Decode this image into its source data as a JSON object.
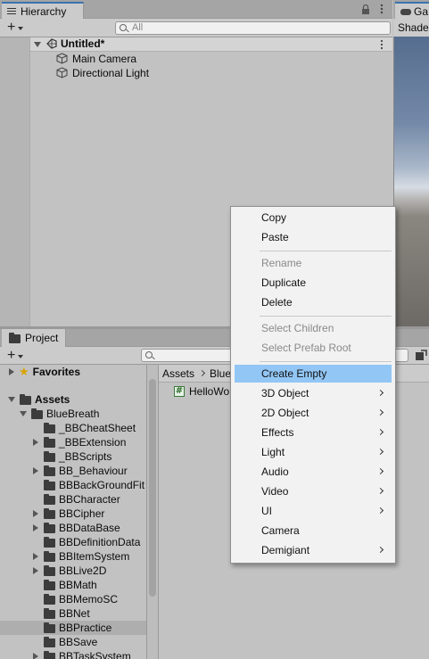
{
  "hierarchy": {
    "tab_label": "Hierarchy",
    "add_label": "+",
    "search_placeholder": "All",
    "scene_name": "Untitled*",
    "objects": [
      "Main Camera",
      "Directional Light"
    ]
  },
  "game_panel": {
    "tab_label": "Ga",
    "toolbar_label": "Shade"
  },
  "project": {
    "tab_label": "Project",
    "add_label": "+",
    "favorites_label": "Favorites",
    "assets_label": "Assets",
    "root_folder": "BlueBreath",
    "folders": [
      {
        "name": "_BBCheatSheet",
        "expandable": false
      },
      {
        "name": "_BBExtension",
        "expandable": true
      },
      {
        "name": "_BBScripts",
        "expandable": false
      },
      {
        "name": "BB_Behaviour",
        "expandable": true
      },
      {
        "name": "BBBackGroundFit",
        "expandable": false
      },
      {
        "name": "BBCharacter",
        "expandable": false
      },
      {
        "name": "BBCipher",
        "expandable": true
      },
      {
        "name": "BBDataBase",
        "expandable": true
      },
      {
        "name": "BBDefinitionData",
        "expandable": false
      },
      {
        "name": "BBItemSystem",
        "expandable": true
      },
      {
        "name": "BBLive2D",
        "expandable": true
      },
      {
        "name": "BBMath",
        "expandable": false
      },
      {
        "name": "BBMemoSC",
        "expandable": false
      },
      {
        "name": "BBNet",
        "expandable": false
      },
      {
        "name": "BBPractice",
        "expandable": false,
        "selected": true
      },
      {
        "name": "BBSave",
        "expandable": false
      },
      {
        "name": "BBTaskSystem",
        "expandable": true
      }
    ],
    "breadcrumb": [
      "Assets",
      "Blue"
    ],
    "files": [
      "HelloWo"
    ]
  },
  "context_menu": {
    "groups": [
      [
        {
          "label": "Copy"
        },
        {
          "label": "Paste"
        }
      ],
      [
        {
          "label": "Rename",
          "disabled": true
        },
        {
          "label": "Duplicate"
        },
        {
          "label": "Delete"
        }
      ],
      [
        {
          "label": "Select Children",
          "disabled": true
        },
        {
          "label": "Select Prefab Root",
          "disabled": true
        }
      ],
      [
        {
          "label": "Create Empty",
          "highlighted": true
        },
        {
          "label": "3D Object",
          "submenu": true
        },
        {
          "label": "2D Object",
          "submenu": true
        },
        {
          "label": "Effects",
          "submenu": true
        },
        {
          "label": "Light",
          "submenu": true
        },
        {
          "label": "Audio",
          "submenu": true
        },
        {
          "label": "Video",
          "submenu": true
        },
        {
          "label": "UI",
          "submenu": true
        },
        {
          "label": "Camera"
        },
        {
          "label": "Demigiant",
          "submenu": true
        }
      ]
    ]
  },
  "colors": {
    "highlight": "#92c6f5",
    "active_tab_accent": "#3a72b0",
    "panel_bg": "#c2c2c2"
  }
}
